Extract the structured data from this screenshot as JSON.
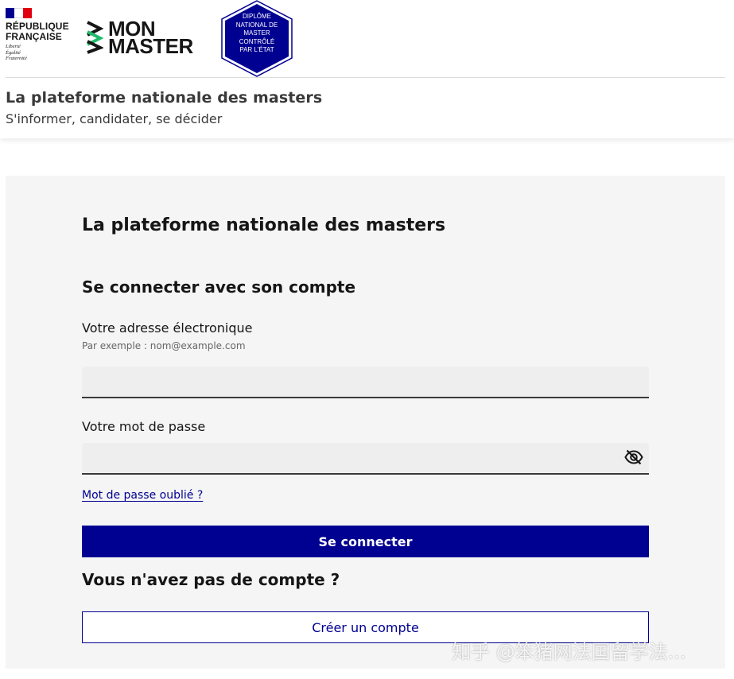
{
  "header": {
    "republique": {
      "name": "RÉPUBLIQUE\nFRANÇAISE",
      "motto": "Liberté\nÉgalité\nFraternité"
    },
    "brand": {
      "logo_text": "MON\nMASTER"
    },
    "badge": {
      "text": "DIPLÔME\nNATIONAL DE\nMASTER\nCONTRÔLÉ\nPAR L'ÉTAT"
    },
    "title": "La plateforme nationale des masters",
    "tagline": "S'informer, candidater, se décider"
  },
  "login": {
    "panel_title": "La plateforme nationale des masters",
    "section_title": "Se connecter avec son compte",
    "email": {
      "label": "Votre adresse électronique",
      "hint": "Par exemple : nom@example.com",
      "value": ""
    },
    "password": {
      "label": "Votre mot de passe",
      "value": "",
      "toggle_icon": "eye-slash-icon"
    },
    "forgot_link": "Mot de passe oublié ?",
    "submit_label": "Se connecter",
    "no_account_title": "Vous n'avez pas de compte ?",
    "create_account_label": "Créer un compte"
  },
  "watermark": "知乎 @笨猪网法国留学法...",
  "colors": {
    "primary": "#000091",
    "panel_bg": "#f5f5f5",
    "input_bg": "#eeeeee",
    "brand_green": "#1fbb6b",
    "flag_red": "#e1000f"
  }
}
